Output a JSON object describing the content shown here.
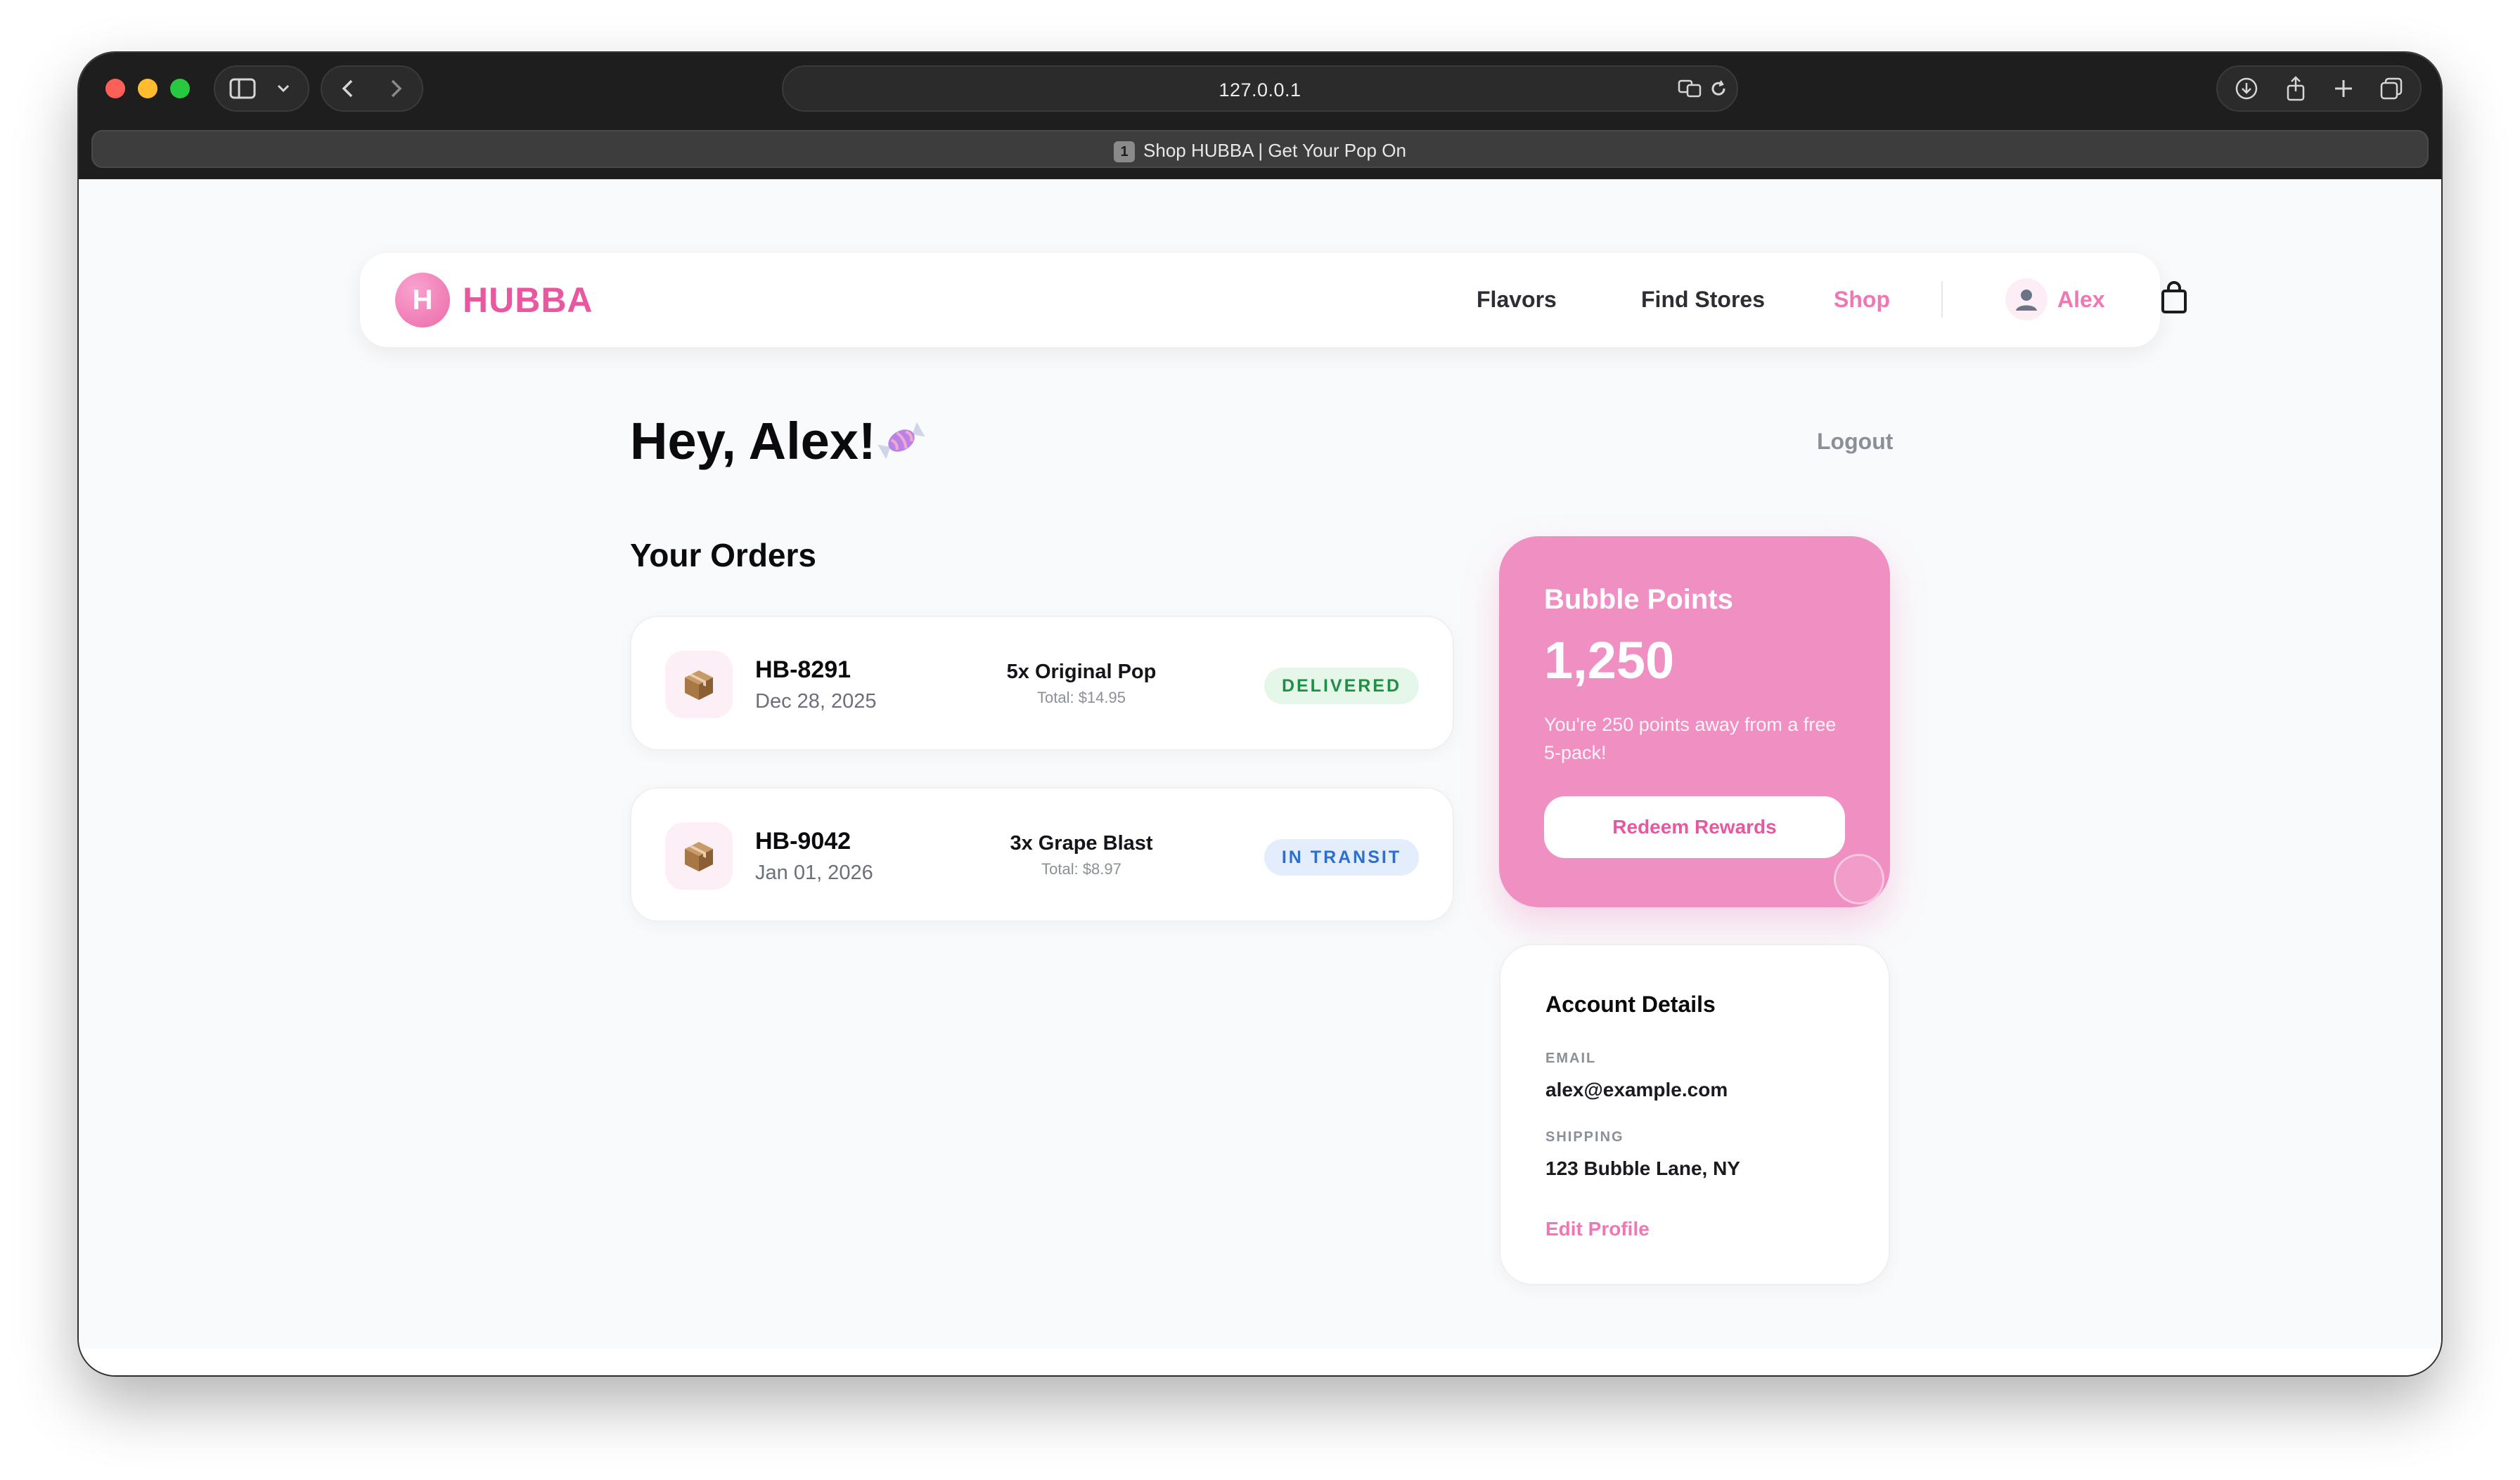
{
  "browser": {
    "url": "127.0.0.1",
    "tab_index": "1",
    "tab_title": "Shop HUBBA | Get Your Pop On"
  },
  "nav": {
    "logo_letter": "H",
    "logo_text": "HUBBA",
    "links": [
      "Flavors",
      "Find Stores",
      "Shop"
    ],
    "user_name": "Alex"
  },
  "page": {
    "greeting": "Hey, Alex!",
    "logout": "Logout",
    "orders_title": "Your Orders"
  },
  "orders": [
    {
      "id": "HB-8291",
      "date": "Dec 28, 2025",
      "items": "5x Original Pop",
      "total": "Total: $14.95",
      "status": "DELIVERED"
    },
    {
      "id": "HB-9042",
      "date": "Jan 01, 2026",
      "items": "3x Grape Blast",
      "total": "Total: $8.97",
      "status": "IN TRANSIT"
    }
  ],
  "points": {
    "title": "Bubble Points",
    "value": "1,250",
    "note": "You're 250 points away from a free 5-pack!",
    "redeem": "Redeem Rewards"
  },
  "account": {
    "title": "Account Details",
    "email_label": "EMAIL",
    "email": "alex@example.com",
    "shipping_label": "SHIPPING",
    "shipping": "123 Bubble Lane, NY",
    "edit": "Edit Profile"
  },
  "colors": {
    "brand_pink": "#e8579f",
    "accent_pink": "#ee77b4",
    "points_card": "#ef8fc2",
    "delivered_green": "#1f8f45",
    "transit_blue": "#2b6fd1"
  }
}
